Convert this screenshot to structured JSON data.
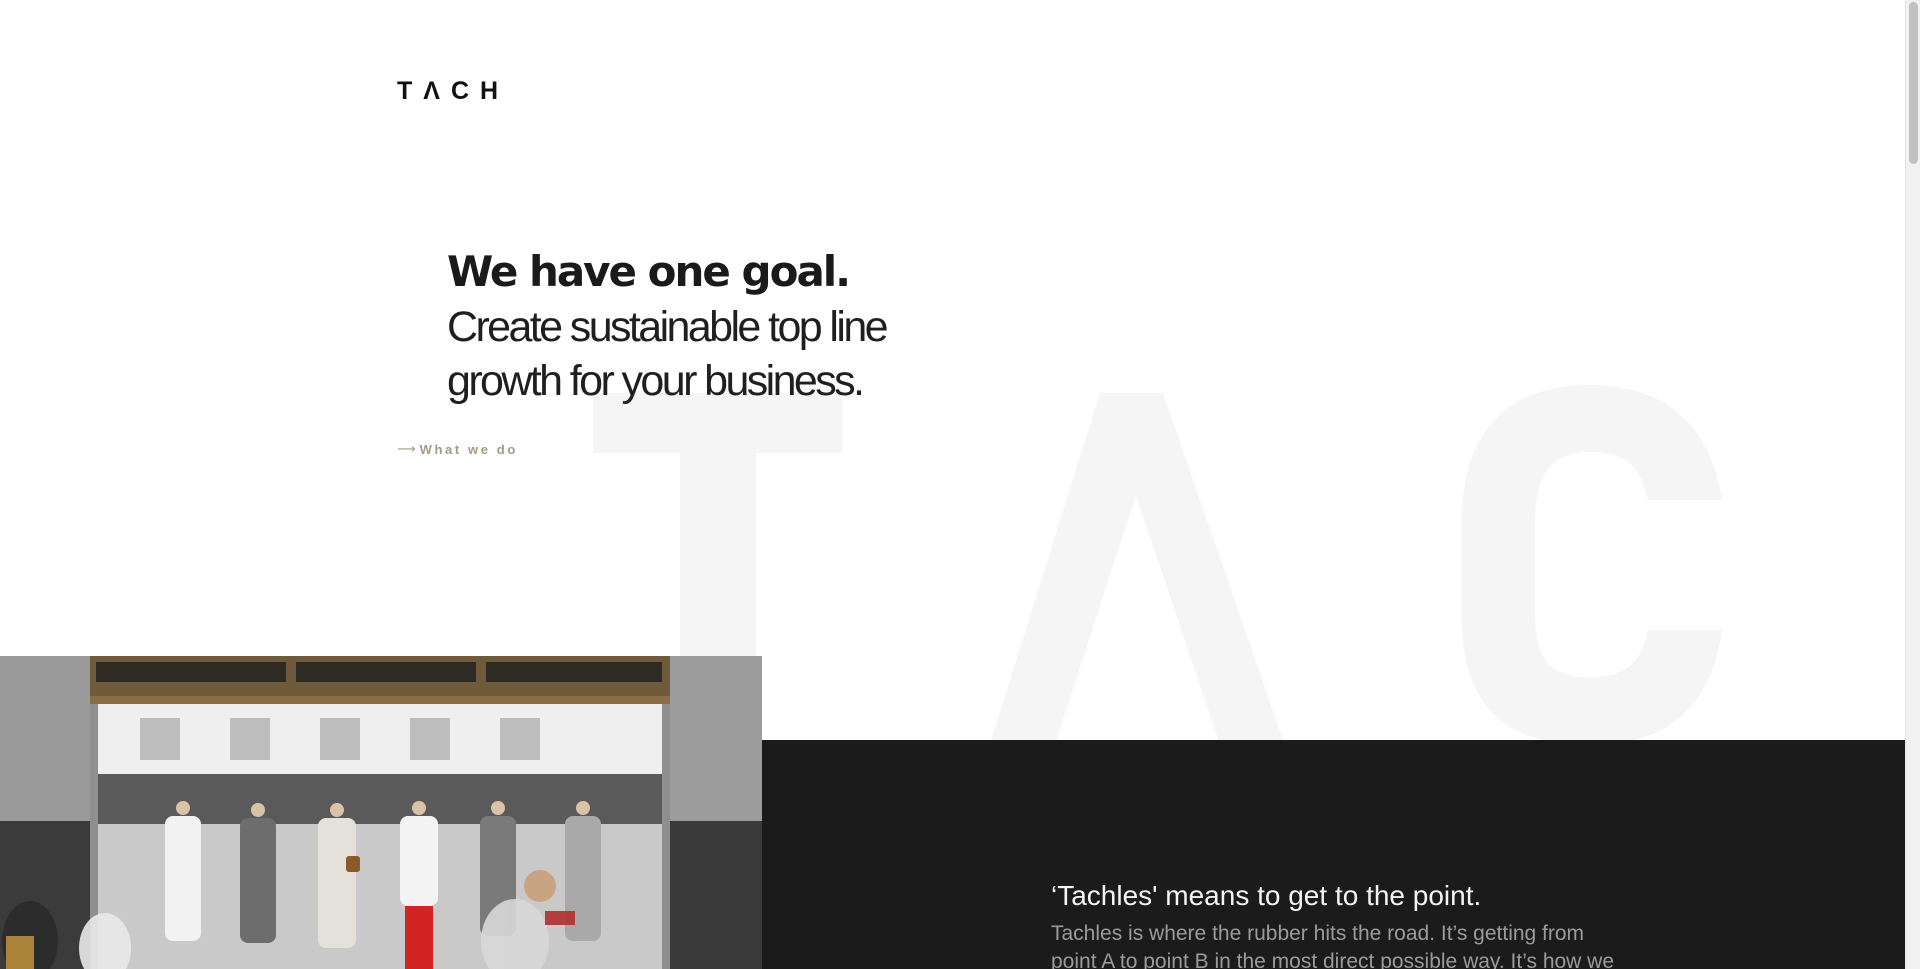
{
  "brand": {
    "logo_text": "TΛCH"
  },
  "hero": {
    "headline_strong": "We have one goal.",
    "headline_line2": "Create sustainable top line",
    "headline_line3": "growth for your business."
  },
  "cta": {
    "arrow": "⟶",
    "label": "What we do"
  },
  "background": {
    "letters": [
      "T",
      "Λ",
      "C"
    ]
  },
  "intro": {
    "title": "‘Tachles' means to get to the point.",
    "body": "Tachles is where the rubber hits the road. It’s getting from point A to point B in the most direct possible way. It’s how we work."
  },
  "colors": {
    "accent": "#a59a86",
    "dark_panel": "#1b1b1b",
    "watermark": "#f5f5f5",
    "text_dark": "#1a1a1a"
  }
}
